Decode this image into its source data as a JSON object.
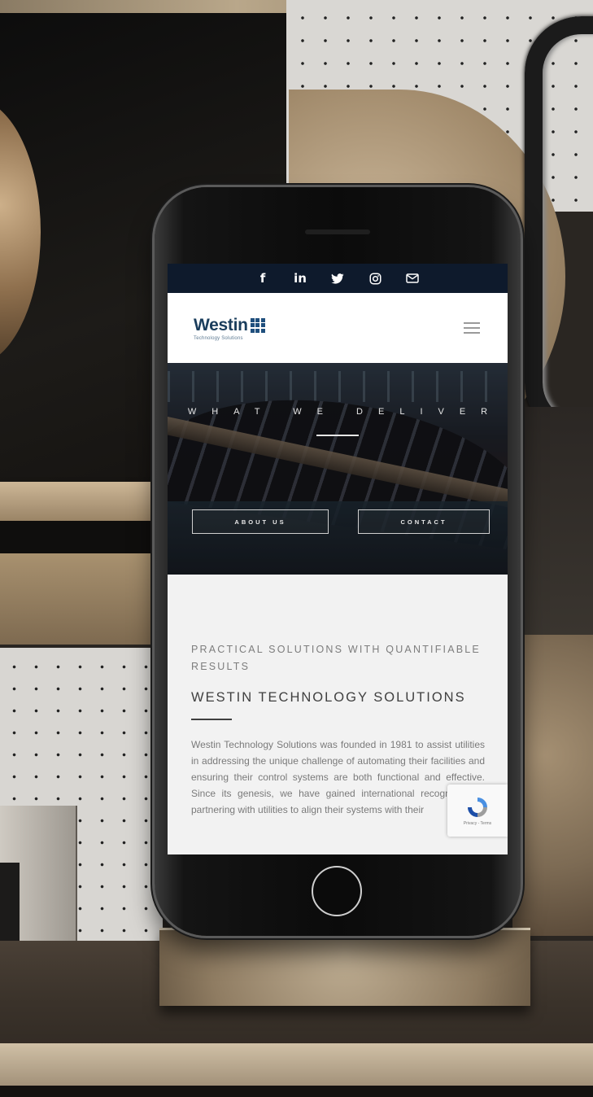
{
  "social": {
    "icons": [
      "facebook-icon",
      "linkedin-icon",
      "twitter-icon",
      "instagram-icon",
      "email-icon"
    ],
    "facebook_glyph": "f",
    "linkedin_glyph": "in"
  },
  "header": {
    "logo_word": "Westin",
    "logo_tagline": "Technology Solutions",
    "menu_icon": "hamburger-menu-icon"
  },
  "hero": {
    "title": "WHAT WE DELIVER",
    "buttons": {
      "about": "ABOUT US",
      "contact": "CONTACT"
    }
  },
  "main": {
    "eyebrow": "PRACTICAL SOLUTIONS WITH QUANTIFIABLE RESULTS",
    "title": "WESTIN TECHNOLOGY SOLUTIONS",
    "body": "Westin Technology Solutions was founded in 1981 to assist utilities in addressing the unique challenge of automating their facilities and ensuring their control systems are both functional and effective. Since its genesis, we have gained international recognition by partnering with utilities to align their systems with their"
  },
  "recaptcha": {
    "text": "Privacy - Terms"
  },
  "colors": {
    "social_bar": "#0e1a2c",
    "logo_blue": "#1a3d5c",
    "page_bg": "#f2f2f2"
  }
}
